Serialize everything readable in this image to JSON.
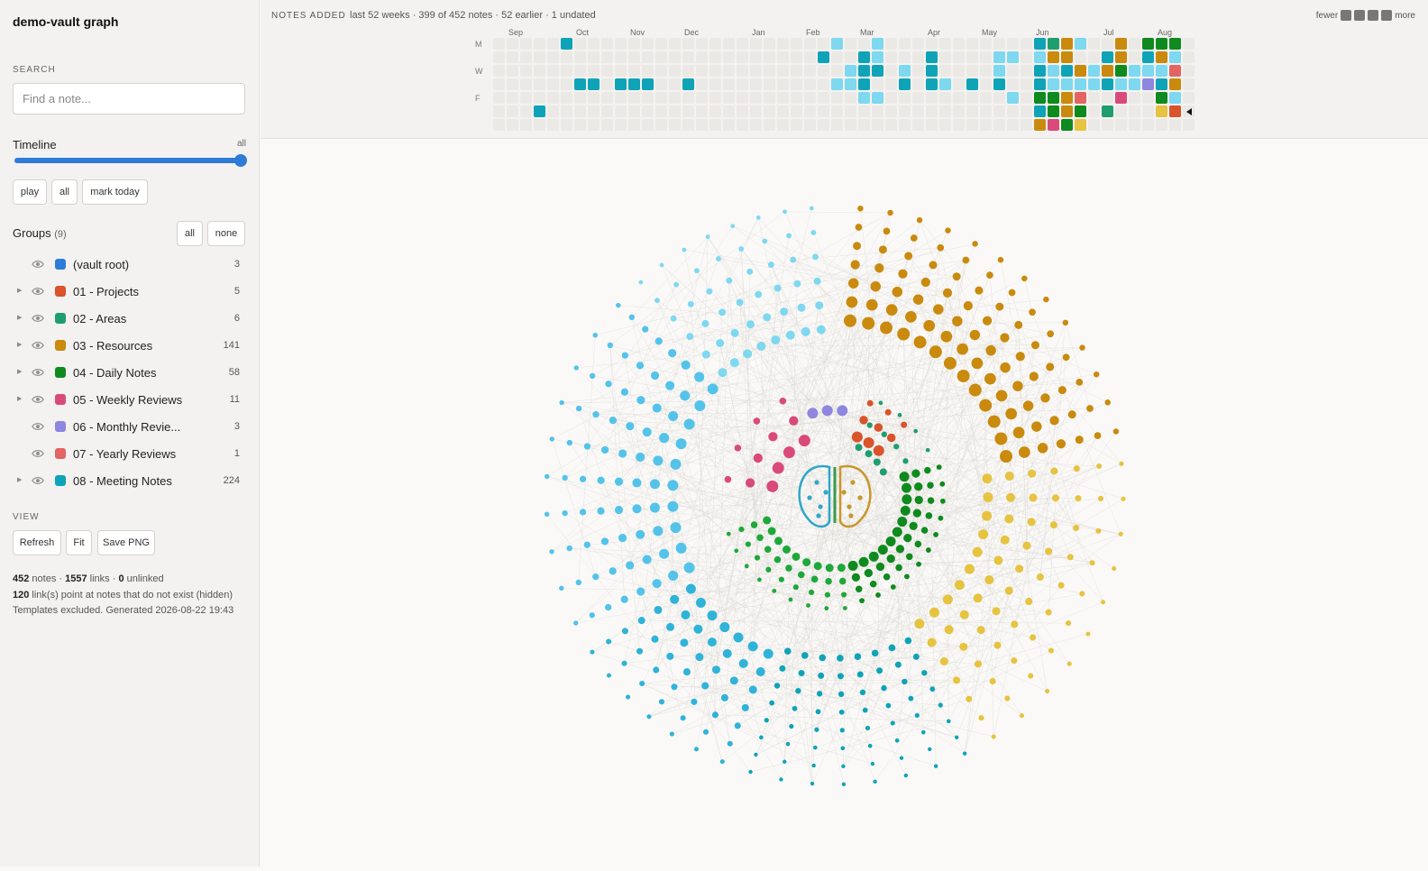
{
  "app": {
    "title": "demo-vault graph"
  },
  "search": {
    "label": "SEARCH",
    "placeholder": "Find a note..."
  },
  "timeline": {
    "label": "Timeline",
    "value": "all",
    "position": 1.0,
    "buttons": {
      "play": "play",
      "all": "all",
      "mark_today": "mark today"
    }
  },
  "groups": {
    "label": "Groups",
    "count_text": "(9)",
    "buttons": {
      "all": "all",
      "none": "none"
    },
    "items": [
      {
        "label": "(vault root)",
        "count": "3",
        "color": "#2f7bd8",
        "expandable": false
      },
      {
        "label": "01 - Projects",
        "count": "5",
        "color": "#d9532b",
        "expandable": true
      },
      {
        "label": "02 - Areas",
        "count": "6",
        "color": "#1e9e6e",
        "expandable": true
      },
      {
        "label": "03 - Resources",
        "count": "141",
        "color": "#c98a0e",
        "expandable": true
      },
      {
        "label": "04 - Daily Notes",
        "count": "58",
        "color": "#0f8a1e",
        "expandable": true
      },
      {
        "label": "05 - Weekly Reviews",
        "count": "11",
        "color": "#d94a7a",
        "expandable": true
      },
      {
        "label": "06 - Monthly Revie...",
        "count": "3",
        "color": "#8f86e0",
        "expandable": false
      },
      {
        "label": "07 - Yearly Reviews",
        "count": "1",
        "color": "#e46464",
        "expandable": false
      },
      {
        "label": "08 - Meeting Notes",
        "count": "224",
        "color": "#0fa3b8",
        "expandable": true
      }
    ]
  },
  "view": {
    "label": "VIEW",
    "buttons": {
      "refresh": "Refresh",
      "fit": "Fit",
      "save_png": "Save PNG"
    }
  },
  "stats": {
    "notes": "452",
    "notes_label": " notes · ",
    "links": "1557",
    "links_label": " links · ",
    "unlinked": "0",
    "unlinked_label": " unlinked",
    "missing": "120",
    "missing_label": " link(s) point at notes that do not exist (hidden)",
    "footer": "Templates excluded. Generated 2026-08-22 19:43"
  },
  "heatmap": {
    "title": "NOTES ADDED",
    "subtitle": "last 52 weeks · 399 of 452 notes · 52 earlier · 1 undated",
    "legend_fewer": "fewer",
    "legend_more": "more",
    "months": [
      {
        "label": "Sep",
        "week": 1
      },
      {
        "label": "Oct",
        "week": 6
      },
      {
        "label": "Nov",
        "week": 10
      },
      {
        "label": "Dec",
        "week": 14
      },
      {
        "label": "Jan",
        "week": 19
      },
      {
        "label": "Feb",
        "week": 23
      },
      {
        "label": "Mar",
        "week": 27
      },
      {
        "label": "Apr",
        "week": 32
      },
      {
        "label": "May",
        "week": 36
      },
      {
        "label": "Jun",
        "week": 40
      },
      {
        "label": "Jul",
        "week": 45
      },
      {
        "label": "Aug",
        "week": 49
      }
    ],
    "day_labels": [
      {
        "label": "M",
        "row": 0
      },
      {
        "label": "W",
        "row": 2
      },
      {
        "label": "F",
        "row": 4
      }
    ],
    "empty_color": "#ebe9e5",
    "cells": [
      [
        5,
        0,
        "#0fa3b8"
      ],
      [
        3,
        5,
        "#0fa3b8"
      ],
      [
        6,
        3,
        "#0fa3b8"
      ],
      [
        7,
        3,
        "#0fa3b8"
      ],
      [
        9,
        3,
        "#0fa3b8"
      ],
      [
        10,
        3,
        "#0fa3b8"
      ],
      [
        11,
        3,
        "#0fa3b8"
      ],
      [
        14,
        3,
        "#0fa3b8"
      ],
      [
        25,
        0,
        "#7dd8f0"
      ],
      [
        24,
        1,
        "#0fa3b8"
      ],
      [
        26,
        2,
        "#7dd8f0"
      ],
      [
        25,
        3,
        "#7dd8f0"
      ],
      [
        28,
        0,
        "#7dd8f0"
      ],
      [
        27,
        1,
        "#0fa3b8"
      ],
      [
        28,
        1,
        "#7dd8f0"
      ],
      [
        27,
        2,
        "#0fa3b8"
      ],
      [
        28,
        2,
        "#0fa3b8"
      ],
      [
        26,
        3,
        "#7dd8f0"
      ],
      [
        27,
        3,
        "#0fa3b8"
      ],
      [
        27,
        4,
        "#7dd8f0"
      ],
      [
        28,
        4,
        "#7dd8f0"
      ],
      [
        30,
        2,
        "#7dd8f0"
      ],
      [
        30,
        3,
        "#0fa3b8"
      ],
      [
        32,
        1,
        "#0fa3b8"
      ],
      [
        32,
        2,
        "#0fa3b8"
      ],
      [
        32,
        3,
        "#0fa3b8"
      ],
      [
        33,
        3,
        "#7dd8f0"
      ],
      [
        35,
        3,
        "#0fa3b8"
      ],
      [
        37,
        1,
        "#7dd8f0"
      ],
      [
        37,
        2,
        "#7dd8f0"
      ],
      [
        37,
        3,
        "#0fa3b8"
      ],
      [
        38,
        1,
        "#7dd8f0"
      ],
      [
        38,
        4,
        "#7dd8f0"
      ],
      [
        40,
        0,
        "#0fa3b8"
      ],
      [
        40,
        1,
        "#7dd8f0"
      ],
      [
        40,
        2,
        "#0fa3b8"
      ],
      [
        40,
        3,
        "#0fa3b8"
      ],
      [
        40,
        4,
        "#0f8a1e"
      ],
      [
        40,
        5,
        "#0fa3b8"
      ],
      [
        40,
        6,
        "#c98a0e"
      ],
      [
        41,
        0,
        "#1e9e6e"
      ],
      [
        41,
        1,
        "#c98a0e"
      ],
      [
        41,
        2,
        "#7dd8f0"
      ],
      [
        41,
        3,
        "#7dd8f0"
      ],
      [
        41,
        4,
        "#0f8a1e"
      ],
      [
        41,
        5,
        "#0f8a1e"
      ],
      [
        41,
        6,
        "#d94a7a"
      ],
      [
        42,
        0,
        "#c98a0e"
      ],
      [
        42,
        1,
        "#c98a0e"
      ],
      [
        42,
        2,
        "#0fa3b8"
      ],
      [
        42,
        3,
        "#7dd8f0"
      ],
      [
        42,
        4,
        "#c98a0e"
      ],
      [
        42,
        5,
        "#c98a0e"
      ],
      [
        42,
        6,
        "#0f8a1e"
      ],
      [
        43,
        0,
        "#7dd8f0"
      ],
      [
        43,
        2,
        "#c98a0e"
      ],
      [
        43,
        3,
        "#7dd8f0"
      ],
      [
        43,
        4,
        "#e46464"
      ],
      [
        43,
        5,
        "#0f8a1e"
      ],
      [
        43,
        6,
        "#e6c340"
      ],
      [
        44,
        2,
        "#7dd8f0"
      ],
      [
        44,
        3,
        "#7dd8f0"
      ],
      [
        45,
        1,
        "#0fa3b8"
      ],
      [
        45,
        2,
        "#c98a0e"
      ],
      [
        45,
        3,
        "#0fa3b8"
      ],
      [
        45,
        5,
        "#1e9e6e"
      ],
      [
        46,
        0,
        "#c98a0e"
      ],
      [
        46,
        1,
        "#c98a0e"
      ],
      [
        46,
        2,
        "#0f8a1e"
      ],
      [
        46,
        3,
        "#7dd8f0"
      ],
      [
        46,
        4,
        "#d94a7a"
      ],
      [
        47,
        2,
        "#7dd8f0"
      ],
      [
        47,
        3,
        "#7dd8f0"
      ],
      [
        48,
        0,
        "#0f8a1e"
      ],
      [
        48,
        1,
        "#0fa3b8"
      ],
      [
        48,
        2,
        "#7dd8f0"
      ],
      [
        48,
        3,
        "#8f86e0"
      ],
      [
        49,
        0,
        "#0f8a1e"
      ],
      [
        49,
        1,
        "#c98a0e"
      ],
      [
        49,
        2,
        "#7dd8f0"
      ],
      [
        49,
        3,
        "#0fa3b8"
      ],
      [
        49,
        4,
        "#0f8a1e"
      ],
      [
        49,
        5,
        "#e6c340"
      ],
      [
        50,
        0,
        "#0f8a1e"
      ],
      [
        50,
        1,
        "#7dd8f0"
      ],
      [
        50,
        2,
        "#e46464"
      ],
      [
        50,
        3,
        "#c98a0e"
      ],
      [
        50,
        4,
        "#7dd8f0"
      ],
      [
        50,
        5,
        "#d9532b"
      ]
    ]
  }
}
